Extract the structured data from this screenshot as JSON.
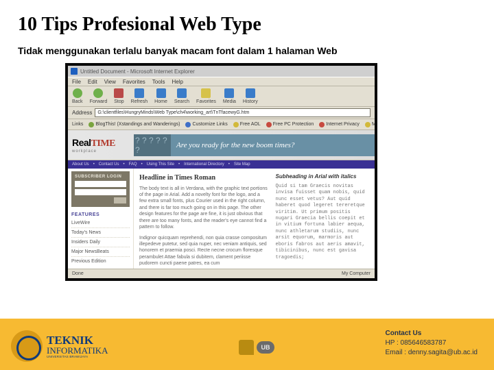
{
  "title": "10 Tips Profesional Web Type",
  "subtitle": "Tidak menggunakan terlalu banyak macam font dalam 1 halaman Web",
  "browser": {
    "window_title": "Untitled Document - Microsoft Internet Explorer",
    "menu": [
      "File",
      "Edit",
      "View",
      "Favorites",
      "Tools",
      "Help"
    ],
    "toolbar": [
      "Back",
      "Forward",
      "Stop",
      "Refresh",
      "Home",
      "Search",
      "Favorites",
      "Media",
      "History"
    ],
    "address_label": "Address",
    "address_value": "G:\\clientfiles\\HungryMinds\\Web Type\\ch4\\working_art\\TnTfacewyG.htm",
    "links_label": "Links",
    "links": [
      "BlogThis! (Xstandings and Wanderings)",
      "Customize Links",
      "Free AOL",
      "Free PC Protection",
      "Internet Privacy",
      "Melissa"
    ],
    "status_left": "Done",
    "status_right": "My Computer"
  },
  "page": {
    "logo_real": "Real",
    "logo_time": "TIME",
    "logo_sub": "workplace",
    "qmarks": "? ? ? ? ? ?",
    "promo": "Are you ready for the new boom times?",
    "crumbs": [
      "About Us",
      "Contact Us",
      "FAQ",
      "Using This Site",
      "International Directory",
      "Site Map"
    ],
    "login_label": "SUBSCRIBER LOGIN",
    "features_label": "FEATURES",
    "side_items": [
      "LiveWire",
      "Today's News",
      "Insiders Daily",
      "Major NewsBeats",
      "Previous Edition"
    ],
    "headline_left": "Headline in Times Roman",
    "body_left_1": "The body text is all in Verdana, with the graphic text portions of the page in Arial. Add a novelty font for the logo, and a few extra small fonts, plus Courier used in the right column, and there is far too much going on in this page. The other design features for the page are fine, it is just obvious that there are too many fonts, and the reader's eye cannot find a pattern to follow.",
    "body_left_2": "Indignor quicquam reprehendi, non quia crasse compositum illepedeve putetur, sed quia nuper, nec veniam antiquis, sed honorem et praemia posci. Recte necne crocum floresque perambulet Attae fabula si dubitem, clament periisse pudorem cuncti paene patres, ea cum",
    "headline_right": "Subheading in Arial with italics",
    "body_right": "Quid si tam Graecis novitas invisa fuisset quam nobis, quid nunc esset vetus? Aut quid haberet quod legeret tereretque viritim. Ut primum positis nugari Graecia bellis coepit et in vitium fortuna labier aequa, nunc athletarum studiis, nunc arsit equorum, marmoris aut eboris fabros aut aeris amavit, tibicinibus, nunc est gavisa tragoedis;"
  },
  "footer": {
    "brand_line1": "TEKNIK",
    "brand_line2": "INFORMATIKA",
    "brand_sub": "UNIVERSITAS BRAWIJAYA",
    "ub": "UB",
    "contact_heading": "Contact Us",
    "contact_hp": "HP : 085646583787",
    "contact_email": "Email : denny.sagita@ub.ac.id"
  }
}
